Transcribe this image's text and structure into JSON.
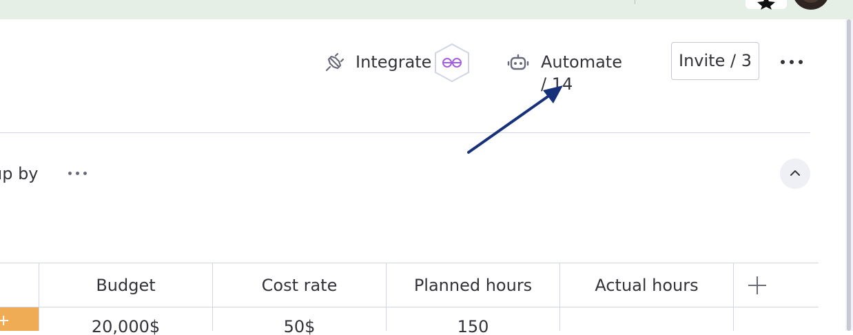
{
  "header": {
    "integrate_label": "Integrate",
    "automate_label": "Automate / 14",
    "invite_label": "Invite / 3"
  },
  "toolbar": {
    "group_by_label": "up by"
  },
  "table": {
    "columns": [
      "Budget",
      "Cost rate",
      "Planned hours",
      "Actual hours"
    ],
    "rows": [
      {
        "budget": "20,000$",
        "cost_rate": "50$",
        "planned_hours": "150",
        "actual_hours": ""
      }
    ]
  },
  "colors": {
    "top_bar": "#e6efe6",
    "annotation_arrow": "#16307a",
    "integrate_accent": "#a25ddc",
    "status_orange": "#f0ac55"
  },
  "icons": {
    "integrate": "plug-icon",
    "integrations_badge": "infinity-hexagon-icon",
    "automate": "robot-icon",
    "more": "more-horizontal-icon",
    "collapse": "chevron-up-icon",
    "add_column": "plus-icon"
  }
}
